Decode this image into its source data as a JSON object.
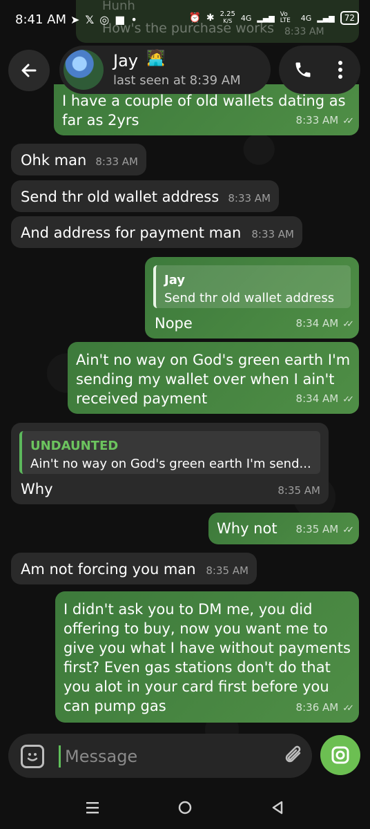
{
  "status_bar": {
    "time": "8:41 AM",
    "speed_value": "2.25",
    "speed_unit": "K/S",
    "network_1": "4G",
    "volte": "Vo LTE",
    "network_2": "4G",
    "battery": "72"
  },
  "ghost_message": {
    "text_top": "Hunh",
    "text": "How's the purchase works",
    "time": "8:33 AM"
  },
  "header": {
    "contact_name": "Jay",
    "contact_emoji": "🧑‍💻",
    "last_seen": "last seen at 8:39 AM"
  },
  "messages": [
    {
      "direction": "out",
      "text_lines": [
        "I have a couple of old wallets dating as",
        "far as 2yrs"
      ],
      "time": "8:33 AM"
    },
    {
      "direction": "in",
      "text": "Ohk man",
      "time": "8:33 AM"
    },
    {
      "direction": "in",
      "text": "Send thr old wallet address",
      "time": "8:33 AM"
    },
    {
      "direction": "in",
      "text": "And address for payment man",
      "time": "8:33 AM"
    },
    {
      "direction": "out",
      "reply_name": "Jay",
      "reply_text": "Send thr old wallet address",
      "text": "Nope",
      "time": "8:34 AM"
    },
    {
      "direction": "out",
      "text_lines": [
        "Ain't no way on God's green earth I'm",
        "sending my wallet over when I ain't",
        "received payment"
      ],
      "time": "8:34 AM"
    },
    {
      "direction": "in",
      "reply_name": "UNDAUNTED",
      "reply_text": "Ain't no way on God's green earth I'm send...",
      "text": "Why",
      "time": "8:35 AM"
    },
    {
      "direction": "out",
      "text": "Why not",
      "time": "8:35 AM"
    },
    {
      "direction": "in",
      "text": "Am not forcing you man",
      "time": "8:35 AM"
    },
    {
      "direction": "out",
      "text_lines": [
        "I didn't ask you to DM me, you did",
        "offering to buy, now you want me to",
        "give you what I have without payments",
        "first? Even gas stations don't do that",
        "you alot in your card first before you",
        "can pump gas"
      ],
      "time": "8:36 AM"
    }
  ],
  "input": {
    "placeholder": "Message"
  },
  "colors": {
    "outgoing_bubble": "#4a8a43",
    "incoming_bubble": "#2a2a2a",
    "accent": "#6cbf52"
  }
}
